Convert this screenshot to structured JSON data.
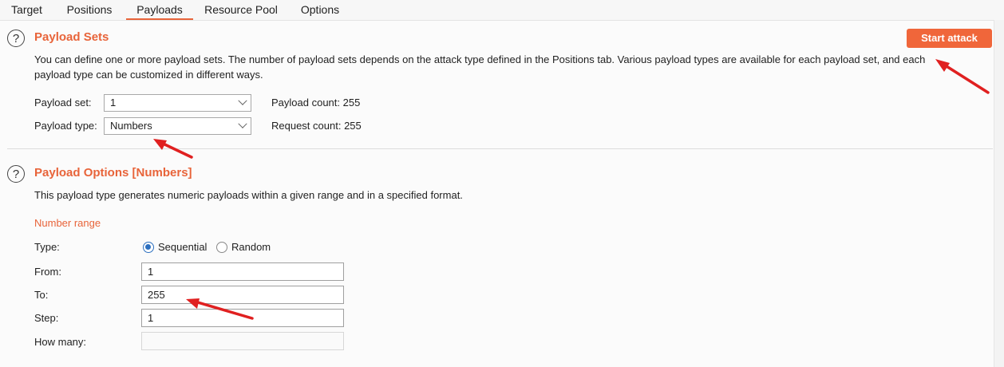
{
  "tabs": [
    "Target",
    "Positions",
    "Payloads",
    "Resource Pool",
    "Options"
  ],
  "payload_sets": {
    "title": "Payload Sets",
    "description_line1": "You can define one or more payload sets. The number of payload sets depends on the attack type defined in the Positions tab. Various payload types are available for each payload set, and each",
    "description_line2": "payload type can be customized in different ways.",
    "payload_set_label": "Payload set:",
    "payload_set_value": "1",
    "payload_type_label": "Payload type:",
    "payload_type_value": "Numbers",
    "payload_count_label": "Payload count:",
    "payload_count_value": "255",
    "request_count_label": "Request count:",
    "request_count_value": "255",
    "start_attack": "Start attack"
  },
  "payload_options": {
    "title": "Payload Options [Numbers]",
    "description": "This payload type generates numeric payloads within a given range and in a specified format.",
    "number_range_heading": "Number range",
    "type_label": "Type:",
    "sequential_label": "Sequential",
    "random_label": "Random",
    "from_label": "From:",
    "from_value": "1",
    "to_label": "To:",
    "to_value": "255",
    "step_label": "Step:",
    "step_value": "1",
    "how_many_label": "How many:",
    "how_many_value": ""
  },
  "colors": {
    "accent": "#e8643a",
    "button": "#f0663a",
    "arrow": "#e02020",
    "radio": "#2c6fbf"
  }
}
